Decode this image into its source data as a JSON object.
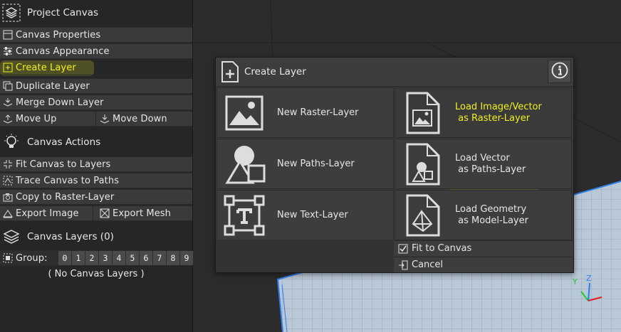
{
  "panel": {
    "project_title": "Project Canvas",
    "project_items": [
      {
        "label": "Canvas Properties",
        "icon": "properties-icon"
      },
      {
        "label": "Canvas Appearance",
        "icon": "sliders-icon"
      },
      {
        "label": "Create Layer",
        "icon": "add-layer-icon",
        "highlighted": true
      },
      {
        "label": "Duplicate Layer",
        "icon": "duplicate-icon"
      },
      {
        "label": "Merge Down Layer",
        "icon": "merge-down-icon"
      }
    ],
    "move_up": "Move Up",
    "move_down": "Move Down",
    "actions_title": "Canvas Actions",
    "action_items": [
      {
        "label": "Fit Canvas to Layers",
        "icon": "fit-icon"
      },
      {
        "label": "Trace Canvas to Paths",
        "icon": "trace-icon"
      },
      {
        "label": "Copy to Raster-Layer",
        "icon": "camera-icon"
      }
    ],
    "export_image": "Export Image",
    "export_mesh": "Export Mesh",
    "layers_title": "Canvas Layers (0)",
    "group_label": "Group:",
    "groups": [
      "0",
      "1",
      "2",
      "3",
      "4",
      "5",
      "6",
      "7",
      "8",
      "9"
    ],
    "empty_text": "( No Canvas Layers )"
  },
  "dialog": {
    "title": "Create Layer",
    "info_icon": "info-icon",
    "tiles": [
      {
        "label": "New Raster-Layer",
        "icon": "image-icon"
      },
      {
        "label": "Load Image/Vector\n as Raster-Layer",
        "icon": "image-file-icon",
        "highlighted": true
      },
      {
        "label": "New Paths-Layer",
        "icon": "shapes-icon"
      },
      {
        "label": "Load Vector\n as Paths-Layer",
        "icon": "shapes-file-icon"
      },
      {
        "label": "New Text-Layer",
        "icon": "text-frame-icon"
      },
      {
        "label": "Load Geometry\n as Model-Layer",
        "icon": "geometry-file-icon"
      }
    ],
    "fit_to_canvas": "Fit to Canvas",
    "fit_checked": true,
    "cancel": "Cancel"
  },
  "viewport": {
    "axis_y": "Y",
    "axis_z": "Z",
    "colors": {
      "grid": "#b9c8d6",
      "border": "#2f7de8",
      "highlight": "#f0f020"
    }
  }
}
